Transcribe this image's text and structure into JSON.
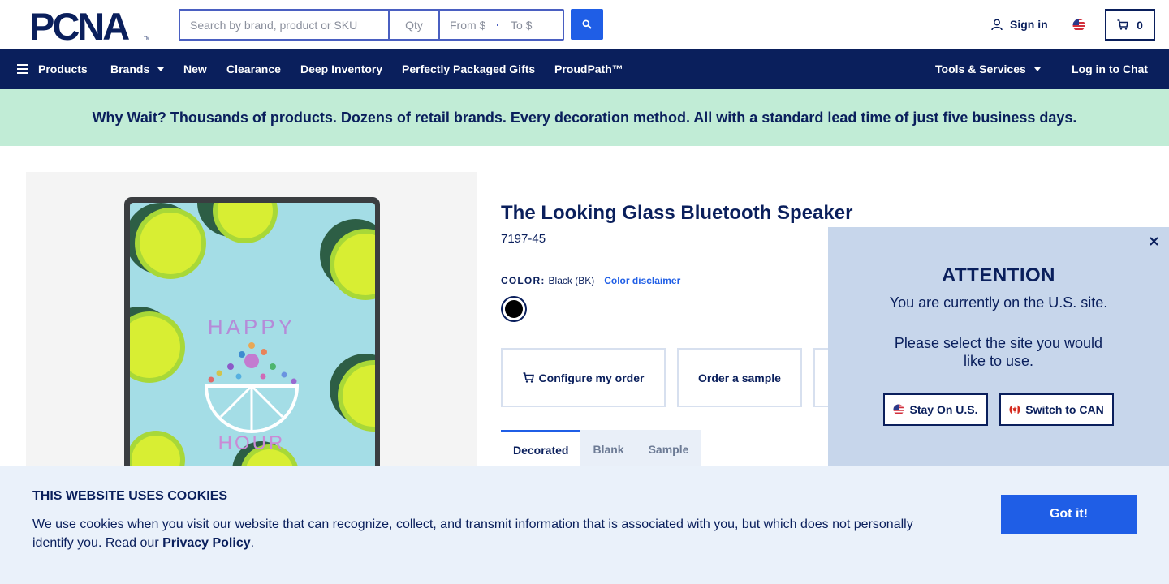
{
  "brand": {
    "logo_text": "PCNA",
    "accent": "#1f5ee6",
    "navy": "#0a1f5c"
  },
  "search": {
    "placeholder": "Search by brand, product or SKU",
    "qty_placeholder": "Qty",
    "from_placeholder": "From $",
    "to_placeholder": "To $"
  },
  "header": {
    "sign_in": "Sign in",
    "cart_count": "0"
  },
  "nav": {
    "products": "Products",
    "brands": "Brands",
    "new": "New",
    "clearance": "Clearance",
    "deep_inventory": "Deep Inventory",
    "gifts": "Perfectly Packaged Gifts",
    "proudpath": "ProudPath™",
    "tools": "Tools & Services",
    "chat": "Log in to Chat"
  },
  "banner": {
    "text": "Why Wait? Thousands of products. Dozens of retail brands. Every decoration method. All with a standard lead time of just five business days."
  },
  "product": {
    "title": "The Looking Glass Bluetooth Speaker",
    "sku": "7197-45",
    "color_label": "COLOR:",
    "color_value": "Black (BK)",
    "color_disclaimer": "Color disclaimer",
    "image_text_top": "HAPPY",
    "image_text_bottom": "HOUR",
    "actions": {
      "configure": "Configure my order",
      "sample": "Order a sample"
    },
    "tabs": [
      "Decorated",
      "Blank",
      "Sample"
    ]
  },
  "site_modal": {
    "heading": "ATTENTION",
    "line1": "You are currently on the U.S. site.",
    "line2": "Please select the site you would like to use.",
    "stay": "Stay On U.S.",
    "switch": "Switch to CAN"
  },
  "cookie": {
    "title": "THIS WEBSITE USES COOKIES",
    "text_before": "We use cookies when you visit our website that can recognize, collect, and transmit information that is associated with you, but which does not personally identify you. Read our ",
    "link": "Privacy Policy",
    "text_after": ".",
    "button": "Got it!"
  }
}
